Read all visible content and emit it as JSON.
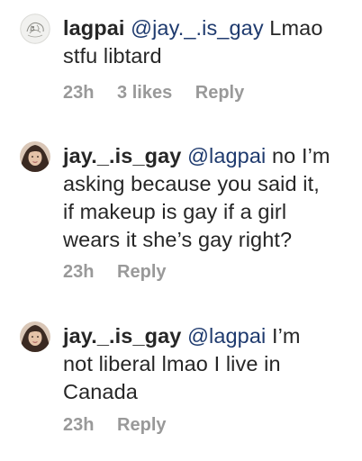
{
  "comments": [
    {
      "username": "lagpai",
      "mention": "@jay._.is_gay",
      "text_line1": " Lmao",
      "text_rest": [
        "stfu libtard"
      ],
      "time": "23h",
      "likes": "3 likes",
      "reply": "Reply"
    },
    {
      "username": "jay._.is_gay",
      "mention": "@lagpai",
      "text_line1": " no I’m",
      "text_rest": [
        "asking because you said it,",
        "if makeup is gay if a girl",
        "wears it she’s gay right?"
      ],
      "time": "23h",
      "reply": "Reply"
    },
    {
      "username": "jay._.is_gay",
      "mention": "@lagpai",
      "text_line1": " I’m",
      "text_rest": [
        "not liberal lmao I live in",
        "Canada"
      ],
      "time": "23h",
      "reply": "Reply"
    }
  ],
  "icons": {
    "avatar1": "avatar-sketch-icon",
    "avatar2": "avatar-photo-icon",
    "avatar3": "avatar-photo-icon"
  }
}
